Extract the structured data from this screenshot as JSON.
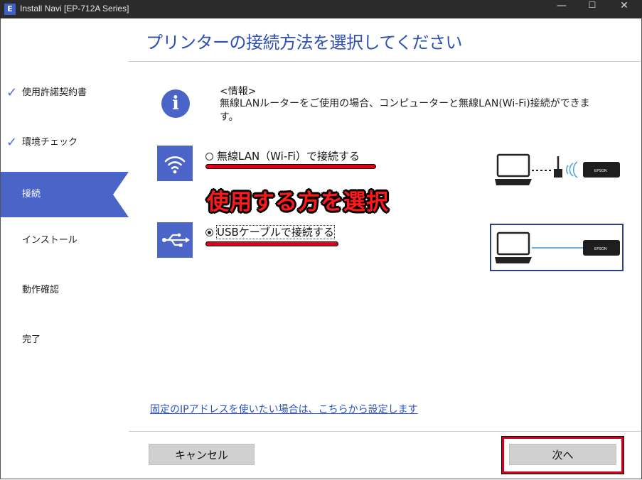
{
  "window": {
    "title": "Install Navi [EP-712A Series]",
    "app_icon": "E",
    "minimize": "—",
    "maximize": "☐",
    "close": "✕"
  },
  "page_title": "プリンターの接続方法を選択してください",
  "steps": [
    {
      "label": "使用許諾契約書",
      "state": "done"
    },
    {
      "label": "環境チェック",
      "state": "done"
    },
    {
      "label": "接続",
      "state": "active"
    },
    {
      "label": "インストール",
      "state": "pending"
    },
    {
      "label": "動作確認",
      "state": "pending"
    },
    {
      "label": "完了",
      "state": "pending"
    }
  ],
  "check_mark": "✓",
  "info": {
    "icon": "i",
    "heading": "<情報>",
    "body": "無線LANルーターをご使用の場合、コンピューターと無線LAN(Wi-Fi)接続ができます。"
  },
  "options": [
    {
      "label": "無線LAN（Wi-Fi）で接続する",
      "selected": false,
      "icon": "wifi-icon"
    },
    {
      "label": "USBケーブルで接続する",
      "selected": true,
      "icon": "usb-icon"
    }
  ],
  "annotation": "使用する方を選択",
  "printer_brand": "EPSON",
  "ip_link": "固定のIPアドレスを使いたい場合は、こちらから設定します",
  "buttons": {
    "cancel": "キャンセル",
    "next": "次へ"
  },
  "colors": {
    "accent": "#4a64c8",
    "title": "#2c50b5",
    "annotation": "#ff1919",
    "link": "#2d52c6"
  }
}
